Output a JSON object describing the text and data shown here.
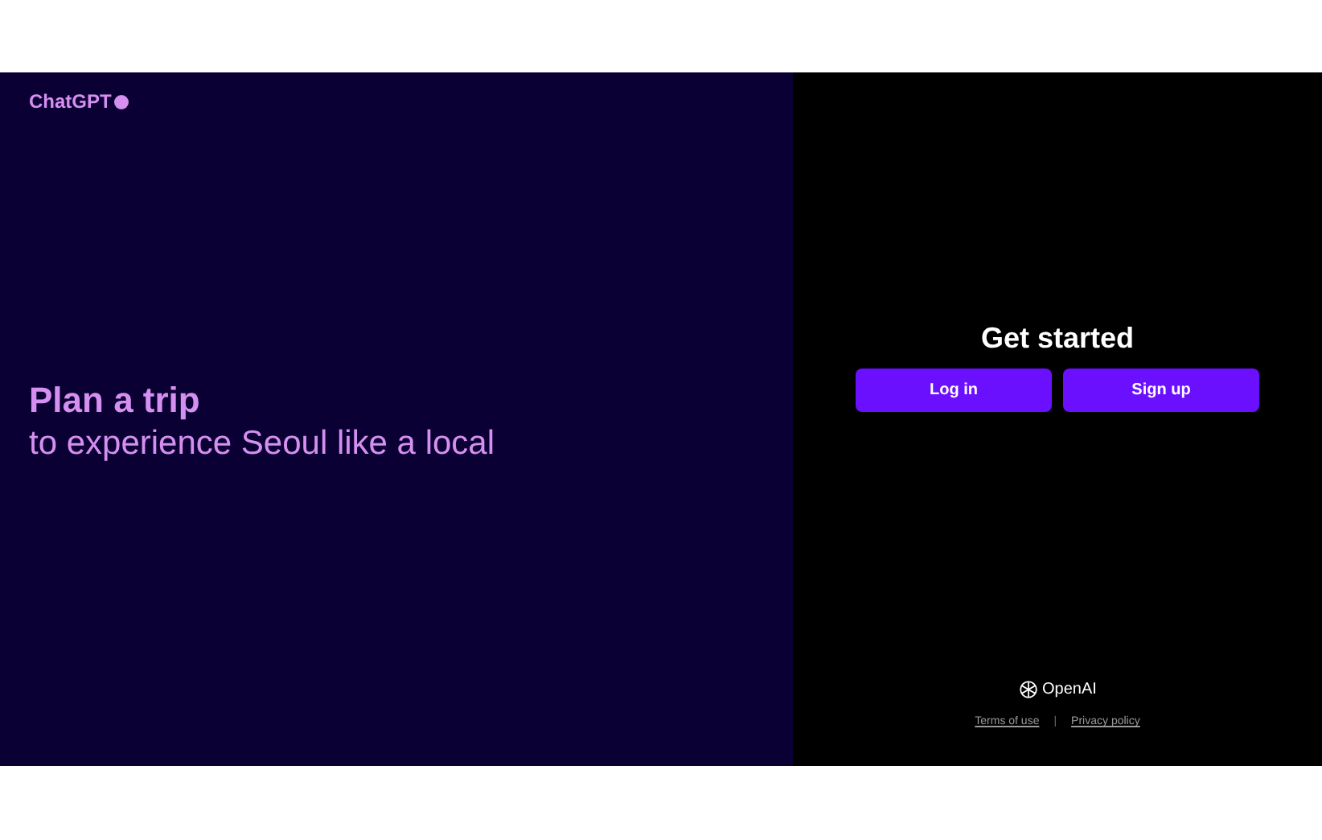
{
  "brand": {
    "name": "ChatGPT"
  },
  "hero": {
    "headline": "Plan a trip",
    "subline": "to experience Seoul like a local"
  },
  "auth": {
    "title": "Get started",
    "buttons": [
      "Log in",
      "Sign up"
    ]
  },
  "footer": {
    "company": "OpenAI",
    "links": [
      "Terms of use",
      "Privacy policy"
    ],
    "separator": "|"
  }
}
